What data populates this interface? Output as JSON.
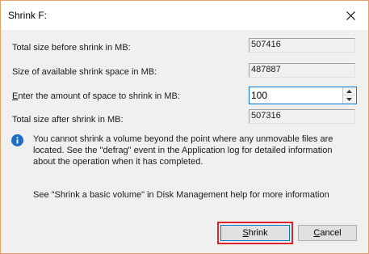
{
  "window": {
    "title": "Shrink F:",
    "close_symbol": "✕"
  },
  "fields": {
    "total_before": {
      "label": "Total size before shrink in MB:",
      "value": "507416"
    },
    "available": {
      "label": "Size of available shrink space in MB:",
      "value": "487887"
    },
    "amount": {
      "label_prefix": "E",
      "label_rest": "nter the amount of space to shrink in MB:",
      "value": "100"
    },
    "total_after": {
      "label": "Total size after shrink in MB:",
      "value": "507316"
    }
  },
  "info": {
    "message": "You cannot shrink a volume beyond the point where any unmovable files are located. See the \"defrag\" event in the Application log for detailed information about the operation when it has completed.",
    "help": "See \"Shrink a basic volume\" in Disk Management help for more information"
  },
  "buttons": {
    "shrink_prefix": "S",
    "shrink_rest": "hrink",
    "cancel_prefix": "C",
    "cancel_rest": "ancel"
  },
  "colors": {
    "accent": "#0078d7",
    "highlight": "#e0232b",
    "window_border": "#e8a06a"
  },
  "icons": {
    "info": "info-icon",
    "close": "close-icon",
    "spin_up": "chevron-up-icon",
    "spin_down": "chevron-down-icon"
  }
}
